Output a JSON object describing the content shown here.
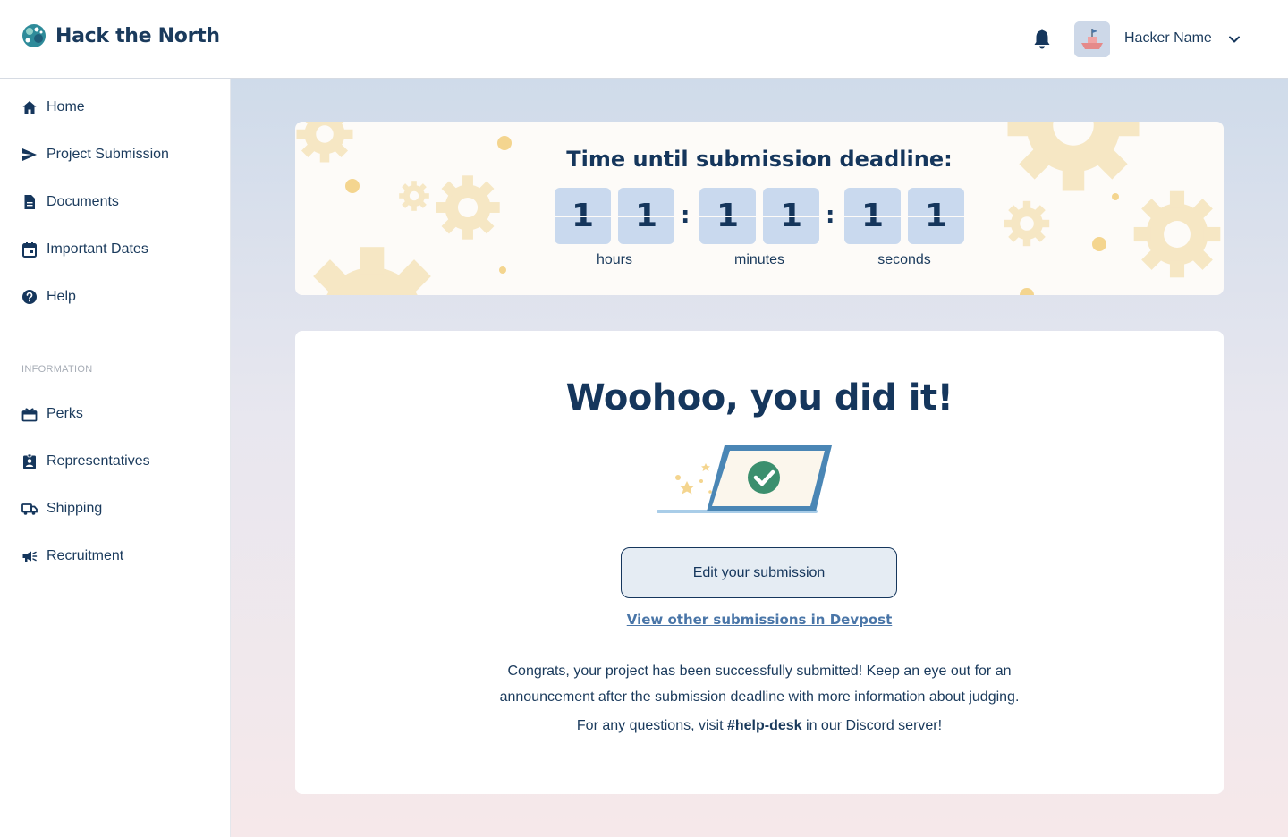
{
  "header": {
    "brand": "Hack the North",
    "user_name": "Hacker Name"
  },
  "sidebar": {
    "items": [
      {
        "label": "Home",
        "icon": "home-icon"
      },
      {
        "label": "Project Submission",
        "icon": "send-icon"
      },
      {
        "label": "Documents",
        "icon": "document-icon"
      },
      {
        "label": "Important Dates",
        "icon": "calendar-icon"
      },
      {
        "label": "Help",
        "icon": "help-icon"
      }
    ],
    "section_label": "INFORMATION",
    "info_items": [
      {
        "label": "Perks",
        "icon": "gift-icon"
      },
      {
        "label": "Representatives",
        "icon": "badge-icon"
      },
      {
        "label": "Shipping",
        "icon": "truck-icon"
      },
      {
        "label": "Recruitment",
        "icon": "megaphone-icon"
      }
    ]
  },
  "timer": {
    "title": "Time until submission deadline:",
    "digits": [
      "1",
      "1",
      "1",
      "1",
      "1",
      "1"
    ],
    "units": [
      "hours",
      "minutes",
      "seconds"
    ]
  },
  "submission": {
    "title": "Woohoo, you did it!",
    "edit_button": "Edit your submission",
    "devpost_link": "View other submissions in Devpost",
    "message": "Congrats, your project has been successfully submitted! Keep an eye out for an announcement after the submission deadline with more information about judging.",
    "help_prefix": "For any questions, visit ",
    "help_channel": "#help-desk",
    "help_suffix": " in our Discord server!"
  },
  "colors": {
    "navy": "#15365c",
    "digit_bg": "#c9d9ee",
    "link": "#4a76a8",
    "gear": "#f6e7c4"
  }
}
